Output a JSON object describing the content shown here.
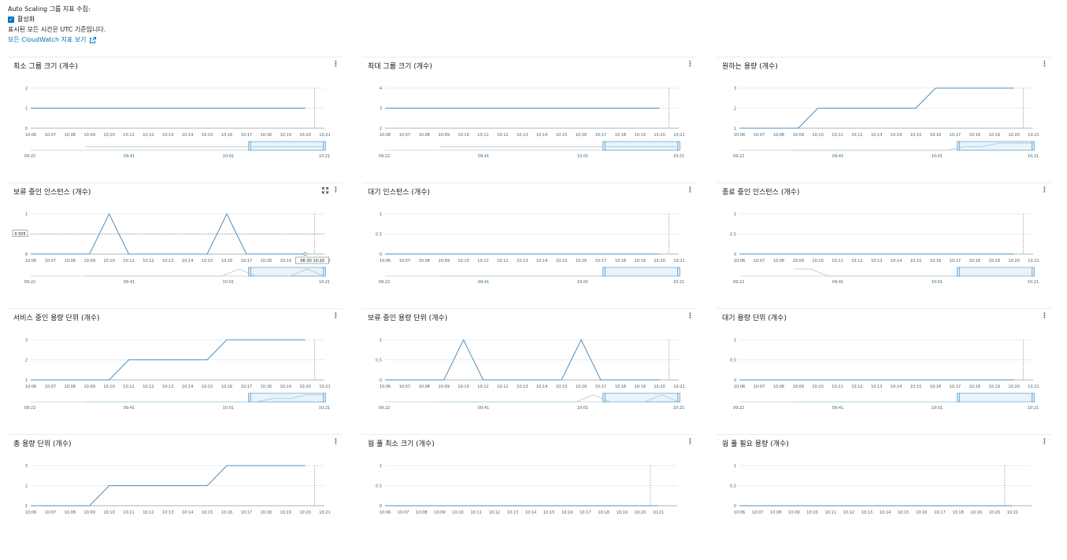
{
  "header": {
    "collect_label": "Auto Scaling 그룹 지표 수집:",
    "enable_label": "활성화",
    "utc_note": "표시된 모든 시간은 UTC 기준입니다.",
    "cloudwatch_link": "모든 CloudWatch 지표 보기"
  },
  "colors": {
    "series": "#4a90c2",
    "accent": "#0073bb",
    "nav_fill": "#e8f3fb"
  },
  "x_ticks": [
    "10:06",
    "10:07",
    "10:08",
    "10:09",
    "10:10",
    "10:11",
    "10:12",
    "10:13",
    "10:14",
    "10:15",
    "10:16",
    "10:17",
    "10:18",
    "10:19",
    "10:20",
    "10:21"
  ],
  "nav_ticks": [
    "09:22",
    "09:41",
    "10:01",
    "10:21"
  ],
  "panels": [
    {
      "title": "최소 그룹 크기 (개수)",
      "y_ticks": [
        "0",
        "1",
        "2"
      ],
      "ylim": [
        0,
        2
      ],
      "values": [
        1,
        1,
        1,
        1,
        1,
        1,
        1,
        1,
        1,
        1,
        1,
        1,
        1,
        1,
        1
      ],
      "nav": [
        1,
        1,
        1,
        1,
        1,
        1,
        1,
        1,
        1,
        1,
        1,
        1,
        1,
        1,
        1
      ]
    },
    {
      "title": "최대 그룹 크기 (개수)",
      "y_ticks": [
        "2",
        "3",
        "4"
      ],
      "ylim": [
        2,
        4
      ],
      "values": [
        3,
        3,
        3,
        3,
        3,
        3,
        3,
        3,
        3,
        3,
        3,
        3,
        3,
        3,
        3
      ],
      "nav": [
        3,
        3,
        3,
        3,
        3,
        3,
        3,
        3,
        3,
        3,
        3,
        3,
        3,
        3,
        3
      ]
    },
    {
      "title": "원하는 용량 (개수)",
      "y_ticks": [
        "1",
        "2",
        "3"
      ],
      "ylim": [
        1,
        3
      ],
      "values": [
        1,
        1,
        1,
        1,
        2,
        2,
        2,
        2,
        2,
        2,
        3,
        3,
        3,
        3,
        3
      ],
      "nav": [
        1,
        1,
        1,
        1,
        1,
        1,
        1,
        1,
        1,
        1,
        2,
        2,
        3,
        3,
        3
      ]
    },
    {
      "title": "보류 중인 인스턴스 (개수)",
      "y_ticks": [
        "0",
        "0.5",
        "1"
      ],
      "ylim": [
        0,
        1
      ],
      "values": [
        0,
        0,
        0,
        0,
        1,
        0,
        0,
        0,
        0,
        0,
        1,
        0,
        0,
        0,
        0
      ],
      "nav": [
        0,
        0,
        0,
        0,
        0,
        0,
        0,
        0,
        0,
        1,
        0,
        0,
        0,
        1,
        0
      ],
      "hover": {
        "value_label": "0.505",
        "time_label": "06-30 10:20"
      }
    },
    {
      "title": "대기 인스턴스 (개수)",
      "y_ticks": [
        "0",
        "0.5",
        "1"
      ],
      "ylim": [
        0,
        1
      ],
      "values": [
        0,
        0,
        0,
        0,
        0,
        0,
        0,
        0,
        0,
        0,
        0,
        0,
        0,
        0,
        0
      ],
      "nav": [
        0,
        0,
        0,
        0,
        0,
        0,
        0,
        0,
        0,
        0,
        0,
        0,
        0,
        0,
        0
      ]
    },
    {
      "title": "종료 중인 인스턴스 (개수)",
      "y_ticks": [
        "0",
        "0.5",
        "1"
      ],
      "ylim": [
        0,
        1
      ],
      "values": [
        0,
        0,
        0,
        0,
        0,
        0,
        0,
        0,
        0,
        0,
        0,
        0,
        0,
        0,
        0
      ],
      "nav": [
        1,
        1,
        0,
        0,
        0,
        0,
        0,
        0,
        0,
        0,
        0,
        0,
        0,
        0,
        0
      ]
    },
    {
      "title": "서비스 중인 용량 단위 (개수)",
      "y_ticks": [
        "1",
        "2",
        "3"
      ],
      "ylim": [
        1,
        3
      ],
      "values": [
        1,
        1,
        1,
        1,
        1,
        2,
        2,
        2,
        2,
        2,
        3,
        3,
        3,
        3,
        3
      ],
      "nav": [
        1,
        1,
        1,
        1,
        1,
        1,
        1,
        1,
        1,
        1,
        1,
        2,
        2,
        3,
        3
      ]
    },
    {
      "title": "보류 중인 용량 단위 (개수)",
      "y_ticks": [
        "0",
        "0.5",
        "1"
      ],
      "ylim": [
        0,
        1
      ],
      "values": [
        0,
        0,
        0,
        0,
        1,
        0,
        0,
        0,
        0,
        0,
        1,
        0,
        0,
        0,
        0
      ],
      "nav": [
        0,
        0,
        0,
        0,
        0,
        0,
        0,
        0,
        0,
        1,
        0,
        0,
        0,
        1,
        0
      ]
    },
    {
      "title": "대기 용량 단위 (개수)",
      "y_ticks": [
        "0",
        "0.5",
        "1"
      ],
      "ylim": [
        0,
        1
      ],
      "values": [
        0,
        0,
        0,
        0,
        0,
        0,
        0,
        0,
        0,
        0,
        0,
        0,
        0,
        0,
        0
      ],
      "nav": [
        0,
        0,
        0,
        0,
        0,
        0,
        0,
        0,
        0,
        0,
        0,
        0,
        0,
        0,
        0
      ]
    },
    {
      "title": "총 용량 단위 (개수)",
      "y_ticks": [
        "1",
        "2",
        "3"
      ],
      "ylim": [
        1,
        3
      ],
      "values": [
        1,
        1,
        1,
        1,
        2,
        2,
        2,
        2,
        2,
        2,
        3,
        3,
        3,
        3,
        3
      ]
    },
    {
      "title": "웜 풀 최소 크기 (개수)",
      "y_ticks": [
        "0",
        "0.5",
        "1"
      ],
      "ylim": [
        0,
        1
      ],
      "values": [
        0,
        0,
        0,
        0,
        0,
        0,
        0,
        0,
        0,
        0,
        0,
        0,
        0,
        0,
        0,
        0
      ]
    },
    {
      "title": "웜 풀 필요 용량 (개수)",
      "y_ticks": [
        "0",
        "0.5",
        "1"
      ],
      "ylim": [
        0,
        1
      ],
      "values": [
        0,
        0,
        0,
        0,
        0,
        0,
        0,
        0,
        0,
        0,
        0,
        0,
        0,
        0,
        0,
        0
      ]
    }
  ]
}
